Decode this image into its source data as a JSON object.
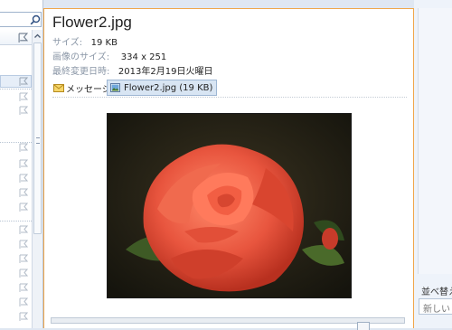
{
  "mail": {
    "title": "Flower2.jpg",
    "size_label": "サイズ:",
    "size_value": "19 KB",
    "dims_label": "画像のサイズ:",
    "dims_value": "334 x 251",
    "modified_label": "最終変更日時:",
    "modified_value": "2013年2月19日火曜日"
  },
  "attachments": {
    "message_tab": "メッセージ",
    "file_tab": "Flower2.jpg (19 KB)"
  },
  "right_panel": {
    "sort_label": "並べ替え",
    "sort_value": "新しいり"
  },
  "colors": {
    "accent_border": "#f0a64a",
    "selected_attachment": "#d8e5f3",
    "rose": "#e8553e"
  },
  "icons": [
    "search-icon",
    "flag-icon",
    "mail-icon",
    "image-file-icon",
    "scroll-up-icon",
    "scroll-down-icon"
  ]
}
